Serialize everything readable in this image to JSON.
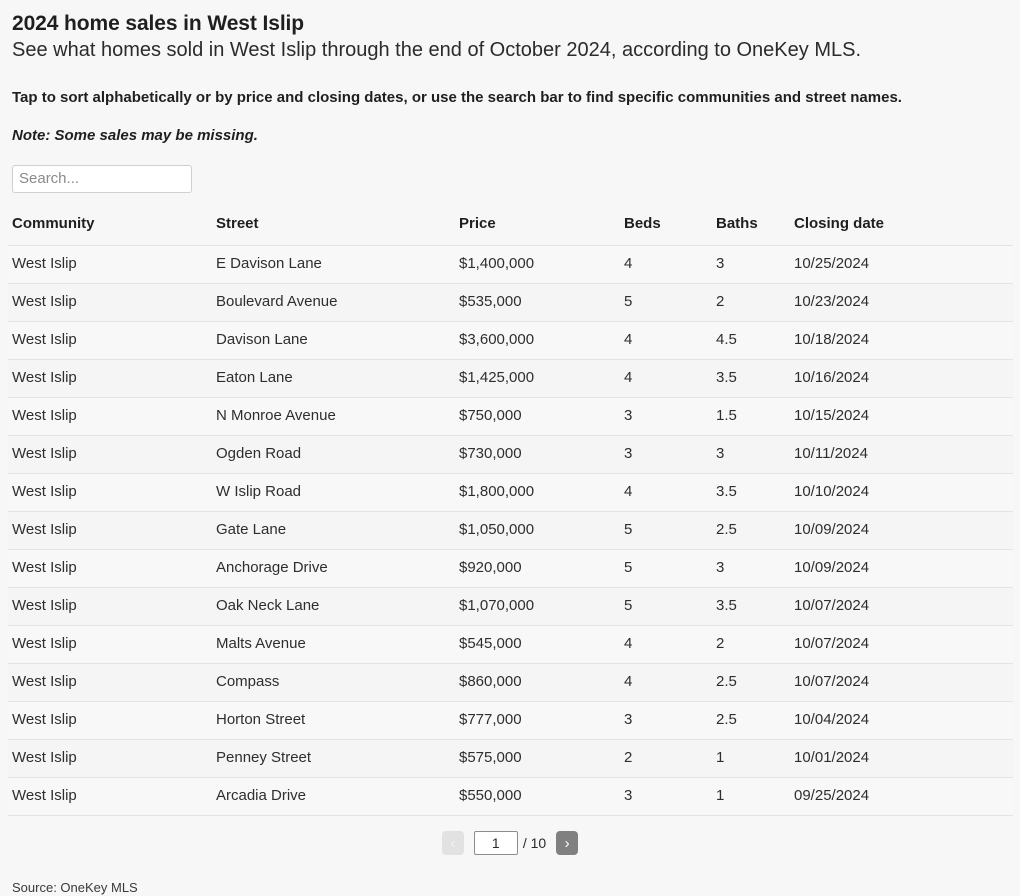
{
  "header": {
    "title": "2024 home sales in West Islip",
    "subtitle": "See what homes sold in West Islip through the end of October 2024, according to OneKey MLS.",
    "instructions": "Tap to sort alphabetically or by price and closing dates, or use the search bar to find specific communities and street names.",
    "note": "Note: Some sales may be missing."
  },
  "search": {
    "placeholder": "Search...",
    "value": ""
  },
  "table": {
    "columns": [
      "Community",
      "Street",
      "Price",
      "Beds",
      "Baths",
      "Closing date"
    ],
    "rows": [
      {
        "community": "West Islip",
        "street": "E Davison Lane",
        "price": "$1,400,000",
        "beds": "4",
        "baths": "3",
        "closing_date": "10/25/2024"
      },
      {
        "community": "West Islip",
        "street": "Boulevard Avenue",
        "price": "$535,000",
        "beds": "5",
        "baths": "2",
        "closing_date": "10/23/2024"
      },
      {
        "community": "West Islip",
        "street": "Davison Lane",
        "price": "$3,600,000",
        "beds": "4",
        "baths": "4.5",
        "closing_date": "10/18/2024"
      },
      {
        "community": "West Islip",
        "street": "Eaton Lane",
        "price": "$1,425,000",
        "beds": "4",
        "baths": "3.5",
        "closing_date": "10/16/2024"
      },
      {
        "community": "West Islip",
        "street": "N Monroe Avenue",
        "price": "$750,000",
        "beds": "3",
        "baths": "1.5",
        "closing_date": "10/15/2024"
      },
      {
        "community": "West Islip",
        "street": "Ogden Road",
        "price": "$730,000",
        "beds": "3",
        "baths": "3",
        "closing_date": "10/11/2024"
      },
      {
        "community": "West Islip",
        "street": "W Islip Road",
        "price": "$1,800,000",
        "beds": "4",
        "baths": "3.5",
        "closing_date": "10/10/2024"
      },
      {
        "community": "West Islip",
        "street": "Gate Lane",
        "price": "$1,050,000",
        "beds": "5",
        "baths": "2.5",
        "closing_date": "10/09/2024"
      },
      {
        "community": "West Islip",
        "street": "Anchorage Drive",
        "price": "$920,000",
        "beds": "5",
        "baths": "3",
        "closing_date": "10/09/2024"
      },
      {
        "community": "West Islip",
        "street": "Oak Neck Lane",
        "price": "$1,070,000",
        "beds": "5",
        "baths": "3.5",
        "closing_date": "10/07/2024"
      },
      {
        "community": "West Islip",
        "street": "Malts Avenue",
        "price": "$545,000",
        "beds": "4",
        "baths": "2",
        "closing_date": "10/07/2024"
      },
      {
        "community": "West Islip",
        "street": "Compass",
        "price": "$860,000",
        "beds": "4",
        "baths": "2.5",
        "closing_date": "10/07/2024"
      },
      {
        "community": "West Islip",
        "street": "Horton Street",
        "price": "$777,000",
        "beds": "3",
        "baths": "2.5",
        "closing_date": "10/04/2024"
      },
      {
        "community": "West Islip",
        "street": "Penney Street",
        "price": "$575,000",
        "beds": "2",
        "baths": "1",
        "closing_date": "10/01/2024"
      },
      {
        "community": "West Islip",
        "street": "Arcadia Drive",
        "price": "$550,000",
        "beds": "3",
        "baths": "1",
        "closing_date": "09/25/2024"
      }
    ]
  },
  "pagination": {
    "prev_label": "‹",
    "next_label": "›",
    "current_page": "1",
    "total_label": "/ 10"
  },
  "footer": {
    "source": "Source: OneKey MLS"
  },
  "colors": {
    "page_background": "#f7f7f7",
    "row_odd": "#f8f8f8",
    "row_even": "#f5f5f5",
    "row_border": "#e3e3e3",
    "text": "#2b2b2b",
    "next_button": "#808080",
    "prev_button_disabled": "#e2e2e2"
  }
}
